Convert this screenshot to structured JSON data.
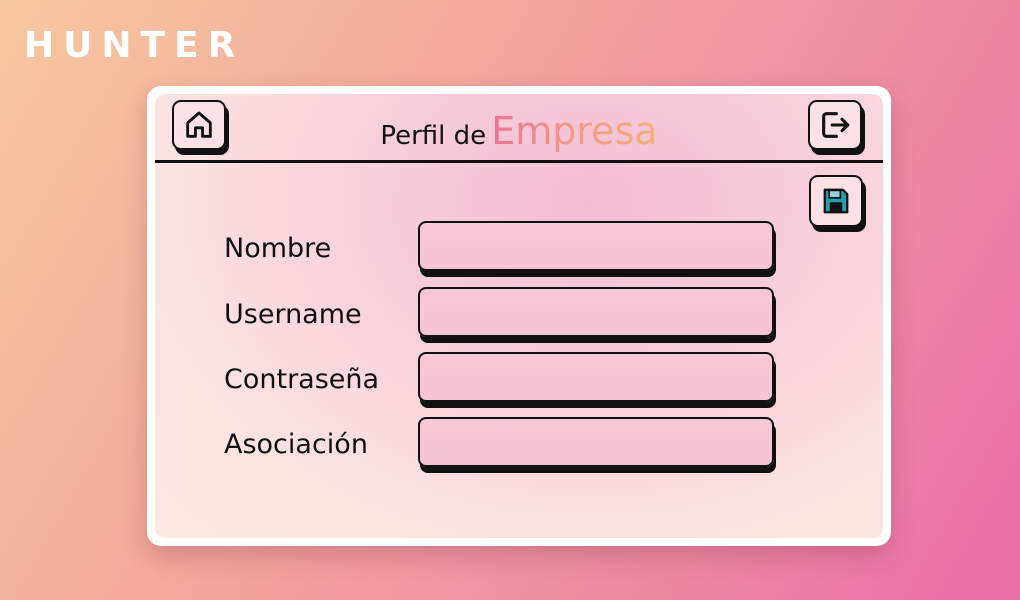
{
  "brand": "HUNTER",
  "header": {
    "title_prefix": "Perfil de",
    "title_accent": "Empresa",
    "home_icon": "home-icon",
    "logout_icon": "logout-icon"
  },
  "toolbar": {
    "save_icon": "save-icon"
  },
  "form": {
    "fields": [
      {
        "label": "Nombre",
        "value": "",
        "placeholder": ""
      },
      {
        "label": "Username",
        "value": "",
        "placeholder": ""
      },
      {
        "label": "Contraseña",
        "value": "",
        "placeholder": ""
      },
      {
        "label": "Asociación",
        "value": "",
        "placeholder": ""
      }
    ]
  },
  "colors": {
    "background_start": "#f6c8a0",
    "background_end": "#ea6fa6",
    "accent_start": "#ea7595",
    "accent_end": "#f5b07a",
    "save_icon": "#2a9db0",
    "outline": "#111111"
  }
}
